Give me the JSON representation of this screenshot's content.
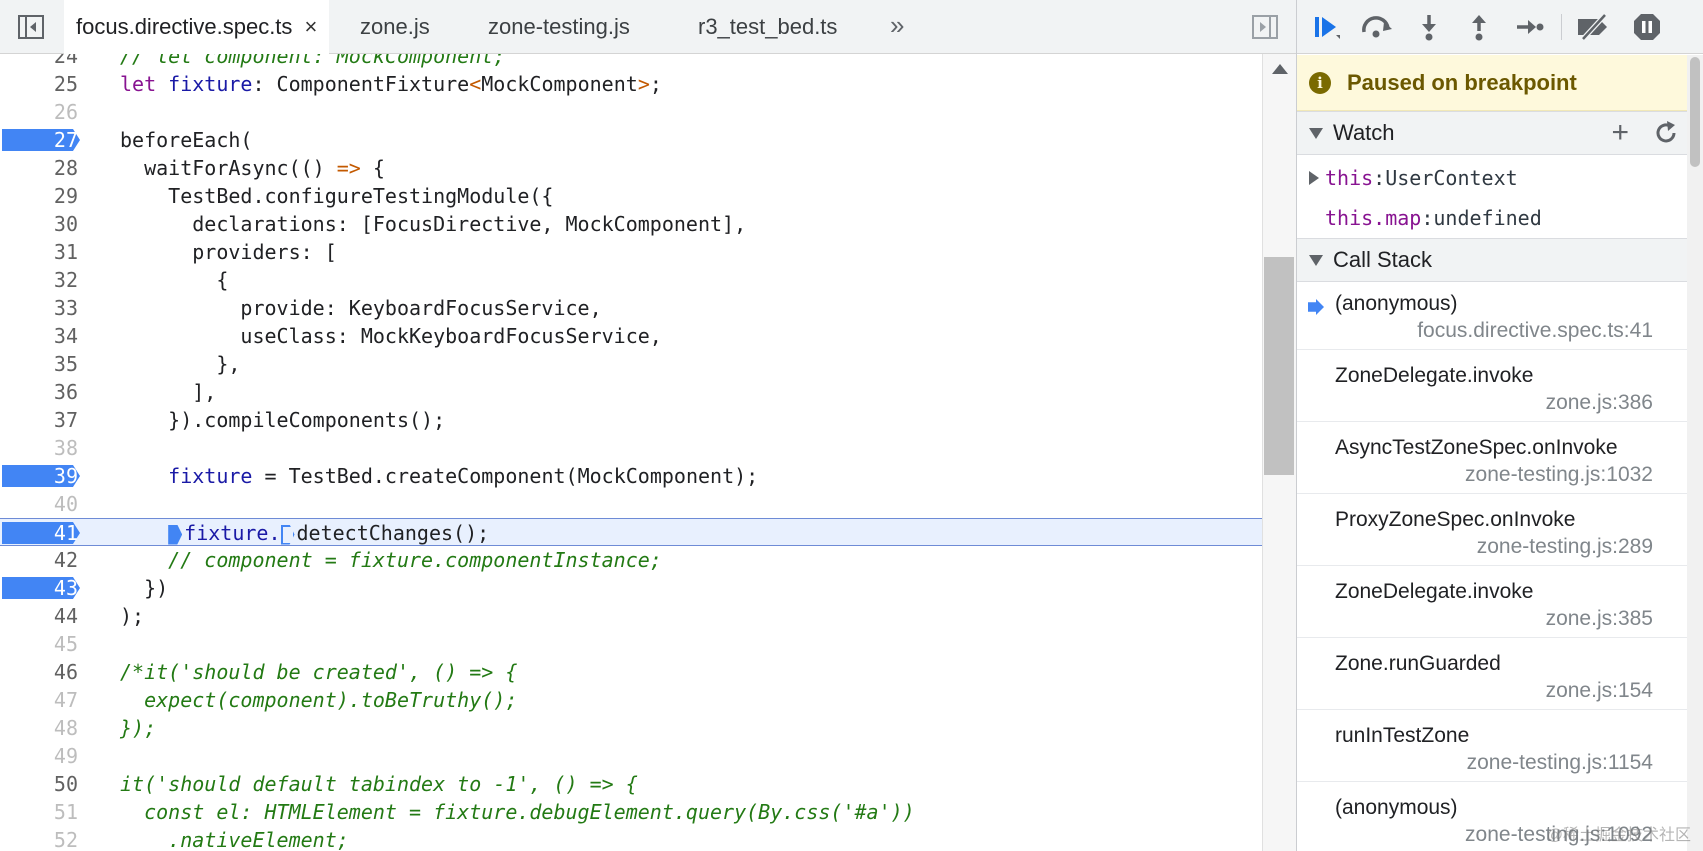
{
  "tabs": [
    {
      "label": "focus.directive.spec.ts",
      "active": true,
      "close": "×"
    },
    {
      "label": "zone.js"
    },
    {
      "label": "zone-testing.js"
    },
    {
      "label": "r3_test_bed.ts"
    }
  ],
  "overflow_label": "»",
  "code": [
    {
      "n": "24"
    },
    {
      "n": "25"
    },
    {
      "n": "26"
    },
    {
      "n": "27",
      "bp": true
    },
    {
      "n": "28"
    },
    {
      "n": "29"
    },
    {
      "n": "30"
    },
    {
      "n": "31"
    },
    {
      "n": "32"
    },
    {
      "n": "33"
    },
    {
      "n": "34"
    },
    {
      "n": "35"
    },
    {
      "n": "36"
    },
    {
      "n": "37"
    },
    {
      "n": "38"
    },
    {
      "n": "39",
      "bp": true
    },
    {
      "n": "40"
    },
    {
      "n": "41",
      "bp": true,
      "current": true
    },
    {
      "n": "42"
    },
    {
      "n": "43",
      "bp": true
    },
    {
      "n": "44"
    },
    {
      "n": "45"
    },
    {
      "n": "46"
    },
    {
      "n": "47"
    },
    {
      "n": "48"
    },
    {
      "n": "49"
    },
    {
      "n": "50"
    },
    {
      "n": "51"
    },
    {
      "n": "52"
    }
  ],
  "code_text": {
    "l24": "// let component: MockComponent;",
    "l25_kw": "let",
    "l25_def": "fixture",
    "l25_rest": ": ComponentFixture",
    "l25_lt": "<",
    "l25_type": "MockComponent",
    "l25_gt": ">",
    "l25_end": ";",
    "l27": "beforeEach(",
    "l28_a": "  waitForAsync(() ",
    "l28_op": "=>",
    "l28_b": " {",
    "l29": "    TestBed.configureTestingModule({",
    "l30": "      declarations: [FocusDirective, MockComponent],",
    "l31": "      providers: [",
    "l32": "        {",
    "l33": "          provide: KeyboardFocusService,",
    "l34": "          useClass: MockKeyboardFocusService,",
    "l35": "        },",
    "l36": "      ],",
    "l37": "    }).compileComponents();",
    "l39_pre": "    ",
    "l39_def": "fixture",
    "l39_rest": " = TestBed.createComponent(MockComponent);",
    "l41_pre": "    ",
    "l41_a": "fixture.",
    "l41_b": "detectChanges();",
    "l42": "    // component = fixture.componentInstance;",
    "l43": "  })",
    "l44": ");",
    "l46": "/*it('should be created', () => {",
    "l47": "  expect(component).toBeTruthy();",
    "l48": "});",
    "l50": "it('should default tabindex to -1', () => {",
    "l51": "  const el: HTMLElement = fixture.debugElement.query(By.css('#a'))",
    "l52": "    .nativeElement;"
  },
  "paused_text": "Paused on breakpoint",
  "watch": {
    "title": "Watch",
    "items": [
      {
        "key": "this",
        "sep": ": ",
        "value": "UserContext",
        "expandable": true
      },
      {
        "key": "this.map",
        "sep": ": ",
        "value": "undefined"
      }
    ]
  },
  "callstack": {
    "title": "Call Stack",
    "frames": [
      {
        "fn": "(anonymous)",
        "loc": "focus.directive.spec.ts:41",
        "current": true
      },
      {
        "fn": "ZoneDelegate.invoke",
        "loc": "zone.js:386"
      },
      {
        "fn": "AsyncTestZoneSpec.onInvoke",
        "loc": "zone-testing.js:1032"
      },
      {
        "fn": "ProxyZoneSpec.onInvoke",
        "loc": "zone-testing.js:289"
      },
      {
        "fn": "ZoneDelegate.invoke",
        "loc": "zone.js:385"
      },
      {
        "fn": "Zone.runGuarded",
        "loc": "zone.js:154"
      },
      {
        "fn": "runInTestZone",
        "loc": "zone-testing.js:1154"
      },
      {
        "fn": "(anonymous)",
        "loc": "zone-testing.js:1092"
      }
    ]
  },
  "watermark": "@稀土掘金技术社区",
  "colors": {
    "breakpoint": "#4285f4",
    "paused_bg": "#fef9dc",
    "current_line": "#e8f0fe"
  }
}
